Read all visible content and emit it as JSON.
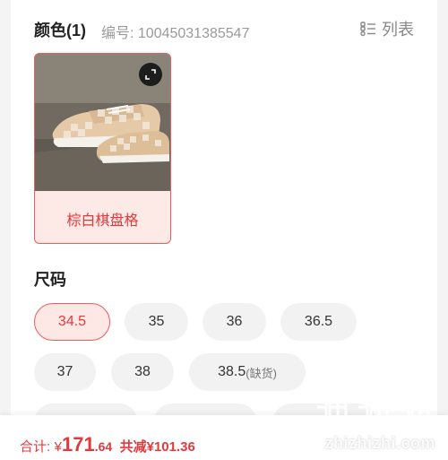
{
  "color_section": {
    "title": "颜色(1)",
    "code_text": "编号: 10045031385547",
    "view_toggle_label": "列表",
    "view_toggle_icon": "list-icon",
    "selected_color_name": "棕白棋盘格",
    "expand_icon": "expand-icon"
  },
  "size_section": {
    "title": "尺码",
    "sizes": [
      {
        "label": "34.5",
        "selected": true
      },
      {
        "label": "35"
      },
      {
        "label": "36"
      },
      {
        "label": "36.5"
      },
      {
        "label": "37"
      },
      {
        "label": "38"
      },
      {
        "label": "38.5",
        "note": "(缺货)"
      }
    ]
  },
  "footer": {
    "total_label": "合计:",
    "currency": "¥",
    "price_int": "171",
    "price_dec": ".64",
    "discount_text": "共减¥101.36"
  },
  "watermark": {
    "text": "zhizhizhi.com"
  },
  "colors": {
    "accent": "#e4393c",
    "selected_bg": "#fde8e5",
    "chip_bg": "#f2f2f2"
  }
}
